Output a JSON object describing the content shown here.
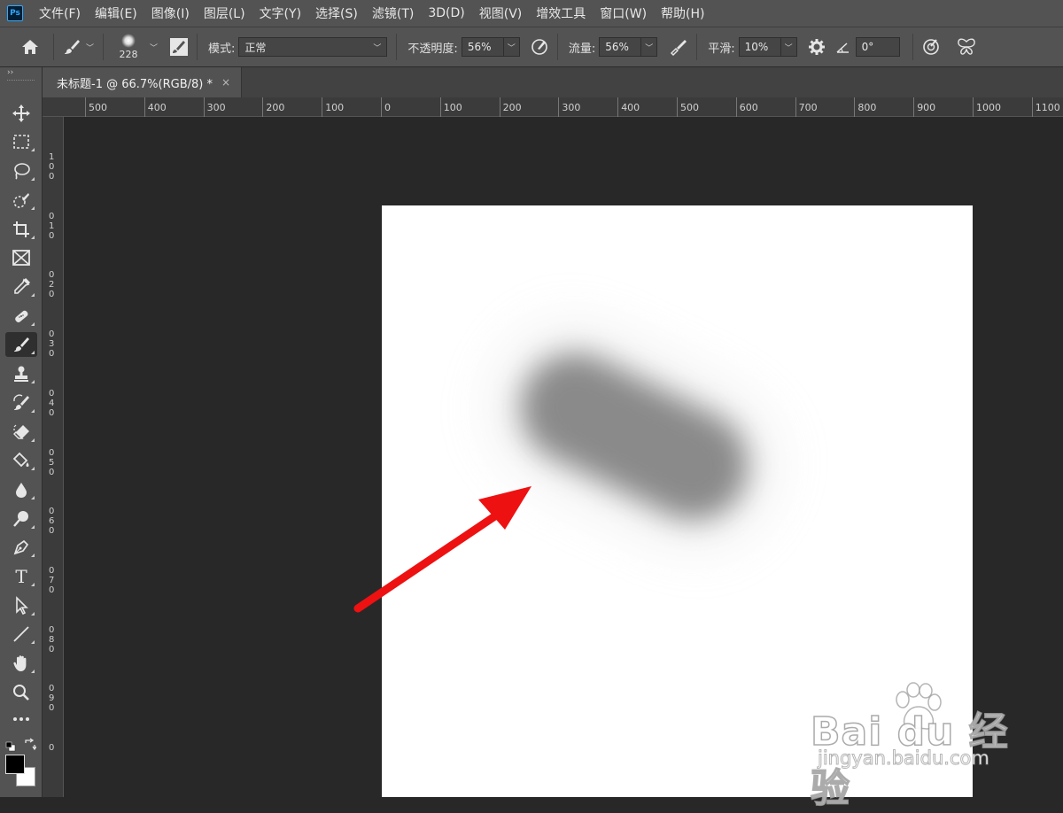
{
  "app": {
    "logo": "Ps"
  },
  "menu": [
    "文件(F)",
    "编辑(E)",
    "图像(I)",
    "图层(L)",
    "文字(Y)",
    "选择(S)",
    "滤镜(T)",
    "3D(D)",
    "视图(V)",
    "增效工具",
    "窗口(W)",
    "帮助(H)"
  ],
  "options": {
    "brush_size": "228",
    "mode_label": "模式:",
    "mode_value": "正常",
    "opacity_label": "不透明度:",
    "opacity_value": "56%",
    "flow_label": "流量:",
    "flow_value": "56%",
    "smooth_label": "平滑:",
    "smooth_value": "10%",
    "angle_value": "0°"
  },
  "document": {
    "tab_title": "未标题-1 @ 66.7%(RGB/8) *",
    "close_glyph": "×",
    "background_color": "#ffffff",
    "stroke_color": "#858585"
  },
  "ruler_top": [
    "500",
    "400",
    "300",
    "200",
    "100",
    "0",
    "100",
    "200",
    "300",
    "400",
    "500",
    "600",
    "700",
    "800",
    "900",
    "1000",
    "1100"
  ],
  "ruler_left": [
    "1",
    "0",
    "0",
    "0",
    "1",
    "0",
    "0",
    "2",
    "0",
    "0",
    "3",
    "0",
    "0",
    "4",
    "0",
    "0",
    "5",
    "0",
    "0",
    "6",
    "0",
    "0",
    "7",
    "0",
    "0",
    "8",
    "0",
    "0",
    "9",
    "0",
    "0"
  ],
  "annotation": {
    "arrow_color": "#ee1111"
  },
  "watermark": {
    "brand": "Bai du 经验",
    "url": "jingyan.baidu.com"
  },
  "colors": {
    "foreground": "#000000",
    "background": "#ffffff",
    "ui_panel": "#535353",
    "workspace": "#282828"
  }
}
